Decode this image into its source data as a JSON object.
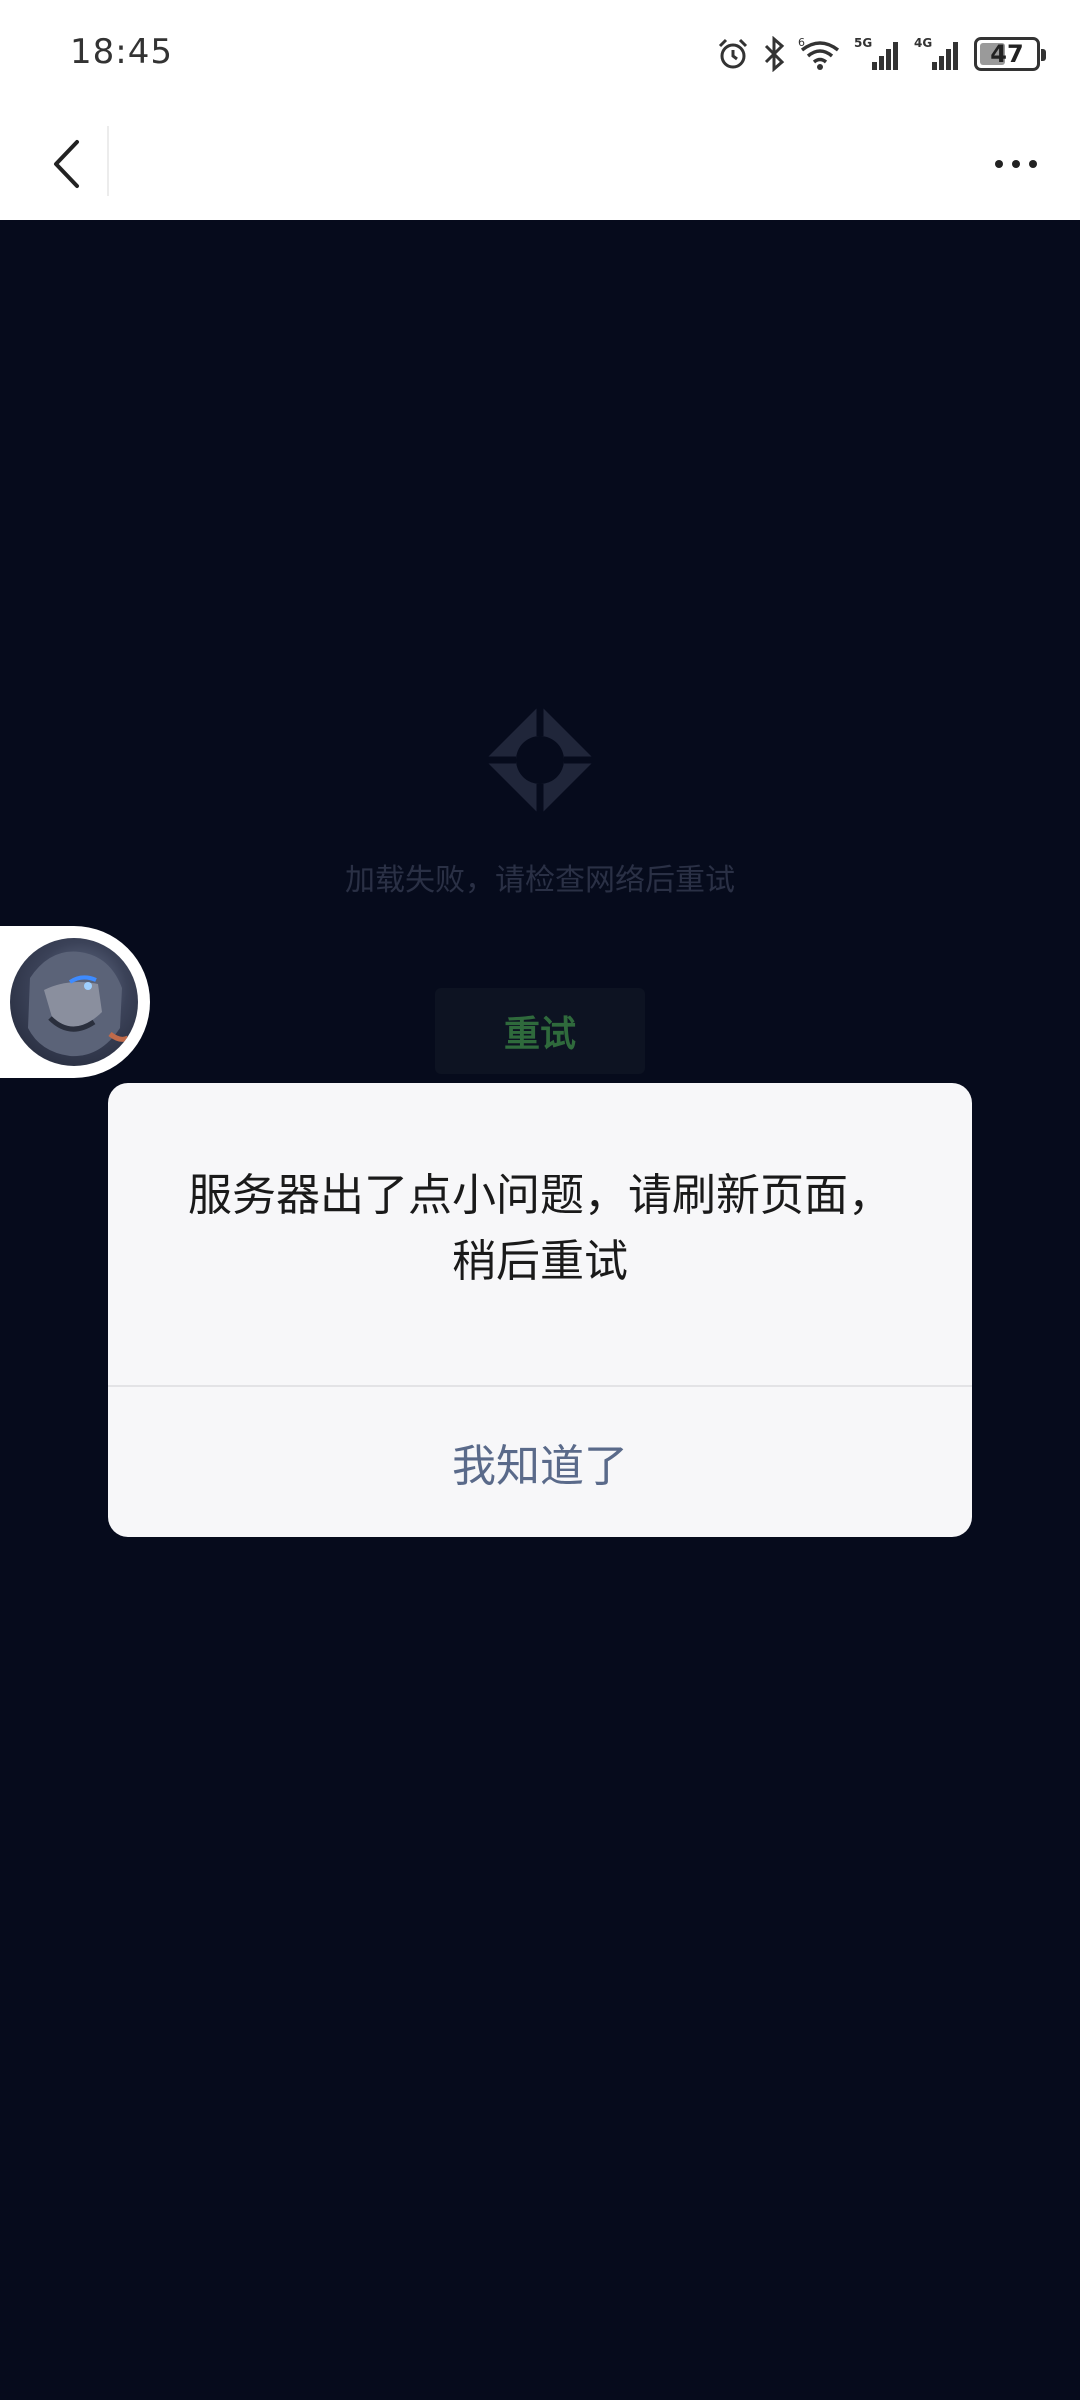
{
  "status_bar": {
    "time": "18:45",
    "battery_level": "47",
    "battery_fraction": 0.47,
    "icons": [
      "alarm-icon",
      "bluetooth-icon",
      "wifi-icon",
      "signal-5g-icon",
      "signal-4g-icon",
      "battery-icon"
    ],
    "wifi_label": "6",
    "network_5g_label": "5G",
    "network_4g_label": "4G"
  },
  "nav": {
    "back_icon": "chevron-left-icon",
    "more_icon": "more-horizontal-icon"
  },
  "content": {
    "error_message": "加载失败，请检查网络后重试",
    "retry_label": "重试",
    "logo_icon": "app-logo-icon"
  },
  "dialog": {
    "message": "服务器出了点小问题，请刷新页面，稍后重试",
    "confirm_label": "我知道了"
  },
  "colors": {
    "page_background": "#060b1c",
    "dialog_background": "#f7f7f9",
    "dialog_button_text": "#5a6a8a",
    "retry_text": "#2f6a3c"
  }
}
